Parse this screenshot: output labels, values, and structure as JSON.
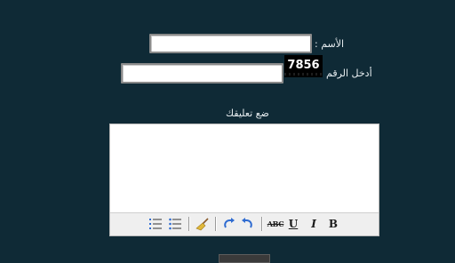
{
  "form": {
    "name_label": "الأسم :",
    "name_value": "",
    "code_label": "أدخل الرقم",
    "code_value": "",
    "captcha_text": "7856",
    "comment_label": "ضع تعليقك",
    "comment_value": ""
  },
  "toolbar": {
    "buttons": [
      {
        "name": "bold",
        "label": "B"
      },
      {
        "name": "italic",
        "label": "I"
      },
      {
        "name": "underline",
        "label": "U"
      },
      {
        "name": "strikethrough",
        "label": "ABC"
      },
      {
        "name": "undo",
        "icon": "undo-icon"
      },
      {
        "name": "redo",
        "icon": "redo-icon"
      },
      {
        "name": "clear-format",
        "icon": "broom-icon"
      },
      {
        "name": "unordered-list",
        "icon": "bullet-list-icon"
      },
      {
        "name": "ordered-list",
        "icon": "numbered-list-icon"
      }
    ]
  },
  "colors": {
    "background": "#0f2a36",
    "label_text": "#e8eef1",
    "captcha_bg": "#000000",
    "icon_blue": "#2e6bd1"
  }
}
